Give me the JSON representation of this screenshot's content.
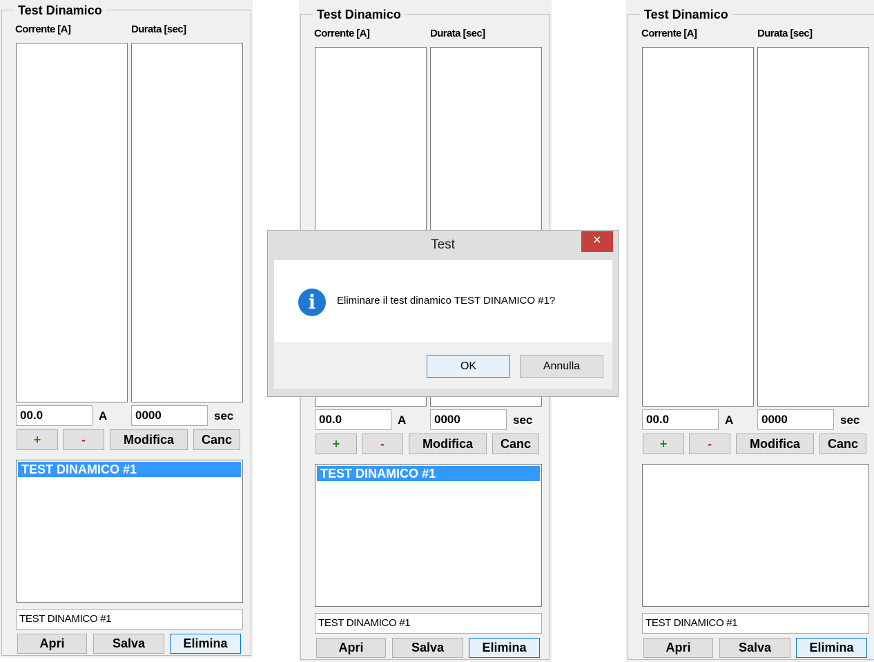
{
  "panel": {
    "group_title": "Test Dinamico",
    "col_current": "Corrente [A]",
    "col_duration": "Durata [sec]",
    "current_value": "00.0",
    "current_unit": "A",
    "duration_value": "0000",
    "duration_unit": "sec",
    "plus_label": "+",
    "minus_label": "-",
    "modify_label": "Modifica",
    "cancel_label": "Canc",
    "test_item": "TEST DINAMICO #1",
    "name_value": "TEST DINAMICO #1",
    "open_label": "Apri",
    "save_label": "Salva",
    "delete_label": "Elimina"
  },
  "dialog": {
    "title": "Test",
    "close_glyph": "✕",
    "icon_glyph": "i",
    "message": "Eliminare il test dinamico TEST DINAMICO #1?",
    "ok_label": "OK",
    "cancel_label": "Annulla"
  },
  "colors": {
    "selection": "#3399ff",
    "close_button": "#c6413b",
    "info_icon": "#1f78d1",
    "plus": "#1e8c1e",
    "minus": "#d42020"
  }
}
